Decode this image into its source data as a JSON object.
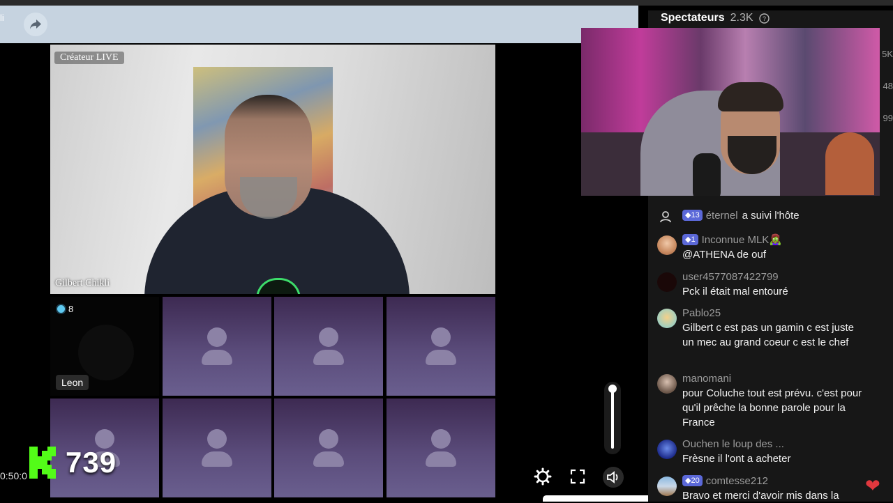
{
  "top_bar": {
    "side_label": "li"
  },
  "host": {
    "creator_tag": "Créateur LIVE",
    "name": "Gilbert Chikli"
  },
  "guests": {
    "leon_name": "Leon",
    "leon_badge_count": "8"
  },
  "overlay": {
    "viewer_number": "739",
    "timestamp": "0:50:0"
  },
  "side_panel": {
    "spectators_label": "Spectateurs",
    "spectators_count": "2.3K",
    "side_numbers": [
      "5K",
      "48",
      "99"
    ]
  },
  "chat": {
    "follow_event": {
      "level": "13",
      "user": "éternel",
      "action": "a suivi l'hôte"
    },
    "messages": [
      {
        "level": "1",
        "user": "Inconnue MLK🧟‍♀️",
        "text": "@ATHENA de ouf"
      },
      {
        "level": "",
        "user": "user4577087422799",
        "text": "Pck il était mal entouré"
      },
      {
        "level": "",
        "user": "Pablo25",
        "text": "Gilbert c est pas un gamin c est juste un mec au grand coeur c est le chef"
      },
      {
        "level": "",
        "user": "manomani",
        "text": "pour Coluche tout est prévu. c'est pour qu'il prêche la bonne parole pour la France"
      },
      {
        "level": "",
        "user": "Ouchen le loup des ...",
        "text": "Frèsne il l'ont a acheter"
      },
      {
        "level": "20",
        "user": "comtesse212",
        "text": "Bravo et merci d'avoir mis dans la"
      }
    ]
  },
  "colors": {
    "accent_green": "#53fc18",
    "level_badge": "#5b68d8",
    "heart": "#e0383e"
  },
  "icons": [
    "share-icon",
    "help-icon",
    "follow-icon",
    "settings-icon",
    "fullscreen-icon",
    "volume-icon",
    "heart-icon",
    "kick-logo-icon"
  ]
}
